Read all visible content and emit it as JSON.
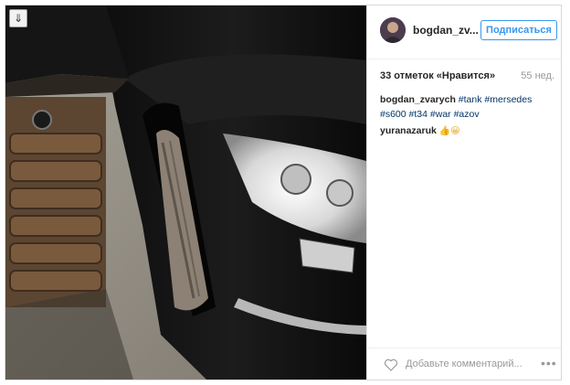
{
  "post": {
    "username": "bogdan_zv...",
    "follow_label": "Подписаться",
    "likes_text": "33 отметок «Нравится»",
    "time_ago": "55 нед.",
    "caption": {
      "author": "bogdan_zvarych",
      "tags": [
        "#tank",
        "#mersedes",
        "#s600",
        "#t34",
        "#war",
        "#azov"
      ]
    },
    "comment": {
      "author": "yuranazaruk",
      "emoji": "👍😀"
    },
    "comment_placeholder": "Добавьте комментарий...",
    "more_label": "•••"
  },
  "icons": {
    "download": "download-icon",
    "heart": "heart-icon",
    "more": "more-options-icon"
  }
}
